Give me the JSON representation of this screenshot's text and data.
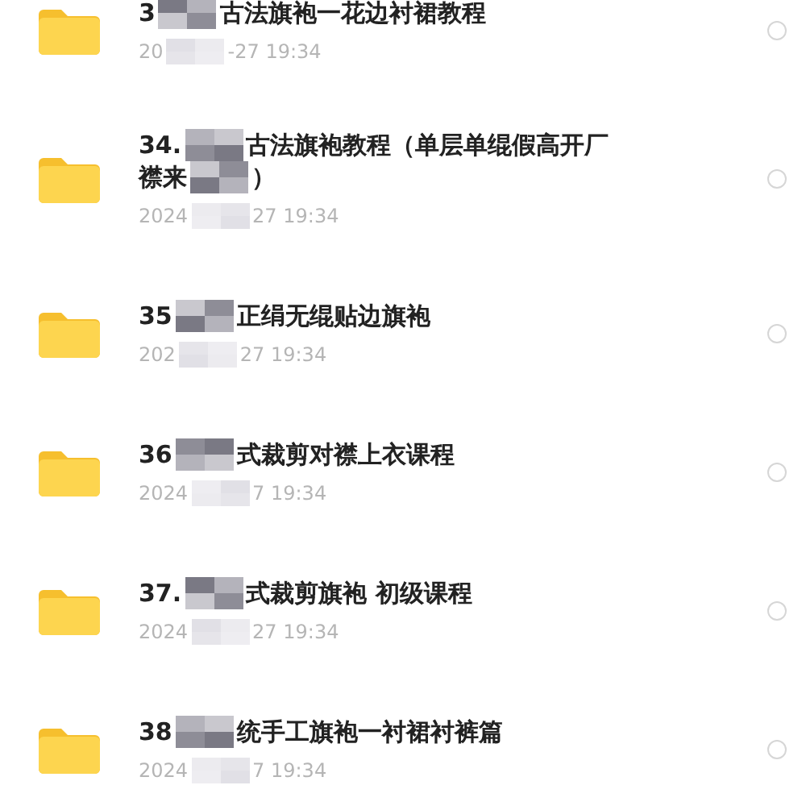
{
  "files": [
    {
      "title_lines": [
        {
          "before": "3",
          "after": "古法旗袍一花边衬裙教程"
        }
      ],
      "date": {
        "before": "20",
        "after": "-27 19:34"
      },
      "selected": false
    },
    {
      "title_lines": [
        {
          "before": "34.",
          "after": "古法旗袍教程（单层单绲假高开厂"
        },
        {
          "before": "襟来",
          "after": "）"
        }
      ],
      "date": {
        "before": "2024",
        "after": "27 19:34"
      },
      "selected": false
    },
    {
      "title_lines": [
        {
          "before": "35",
          "after": "正绢无绲贴边旗袍"
        }
      ],
      "date": {
        "before": "202",
        "after": "27 19:34"
      },
      "selected": false
    },
    {
      "title_lines": [
        {
          "before": "36",
          "after": "式裁剪对襟上衣课程"
        }
      ],
      "date": {
        "before": "2024",
        "after": "7 19:34"
      },
      "selected": false
    },
    {
      "title_lines": [
        {
          "before": "37.",
          "after": "式裁剪旗袍 初级课程"
        }
      ],
      "date": {
        "before": "2024",
        "after": "27 19:34"
      },
      "selected": false
    },
    {
      "title_lines": [
        {
          "before": "38",
          "after": "统手工旗袍一衬裙衬裤篇"
        }
      ],
      "date": {
        "before": "2024",
        "after": "7 19:34"
      },
      "selected": false
    }
  ]
}
